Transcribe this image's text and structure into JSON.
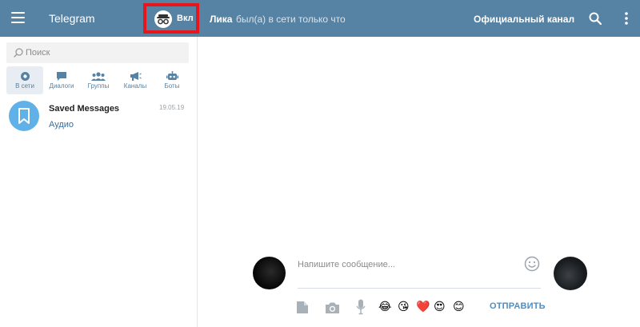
{
  "header": {
    "app_title": "Telegram",
    "incognito_label": "Вкл",
    "peer_name": "Лика",
    "peer_status": "был(а) в сети только что",
    "official_channel": "Официальный канал",
    "bg_color": "#5682a3",
    "highlight_color": "#e8151b"
  },
  "sidebar": {
    "search_placeholder": "Поиск",
    "tabs": [
      {
        "label": "В сети",
        "icon": "online-dot-icon",
        "active": true
      },
      {
        "label": "Диалоги",
        "icon": "chat-bubble-icon",
        "active": false
      },
      {
        "label": "Группы",
        "icon": "group-icon",
        "active": false
      },
      {
        "label": "Каналы",
        "icon": "megaphone-icon",
        "active": false
      },
      {
        "label": "Боты",
        "icon": "robot-icon",
        "active": false
      }
    ],
    "chats": [
      {
        "name": "Saved Messages",
        "date": "19.05.19",
        "preview": "Аудио",
        "avatar_color": "#5fb1e8",
        "icon": "bookmark-icon"
      }
    ]
  },
  "composer": {
    "placeholder": "Напишите сообщение...",
    "send_label": "ОТПРАВИТЬ",
    "emojis": [
      "😂",
      "😘",
      "❤️",
      "😍",
      "😊"
    ],
    "accent_color": "#4a8ec6"
  }
}
